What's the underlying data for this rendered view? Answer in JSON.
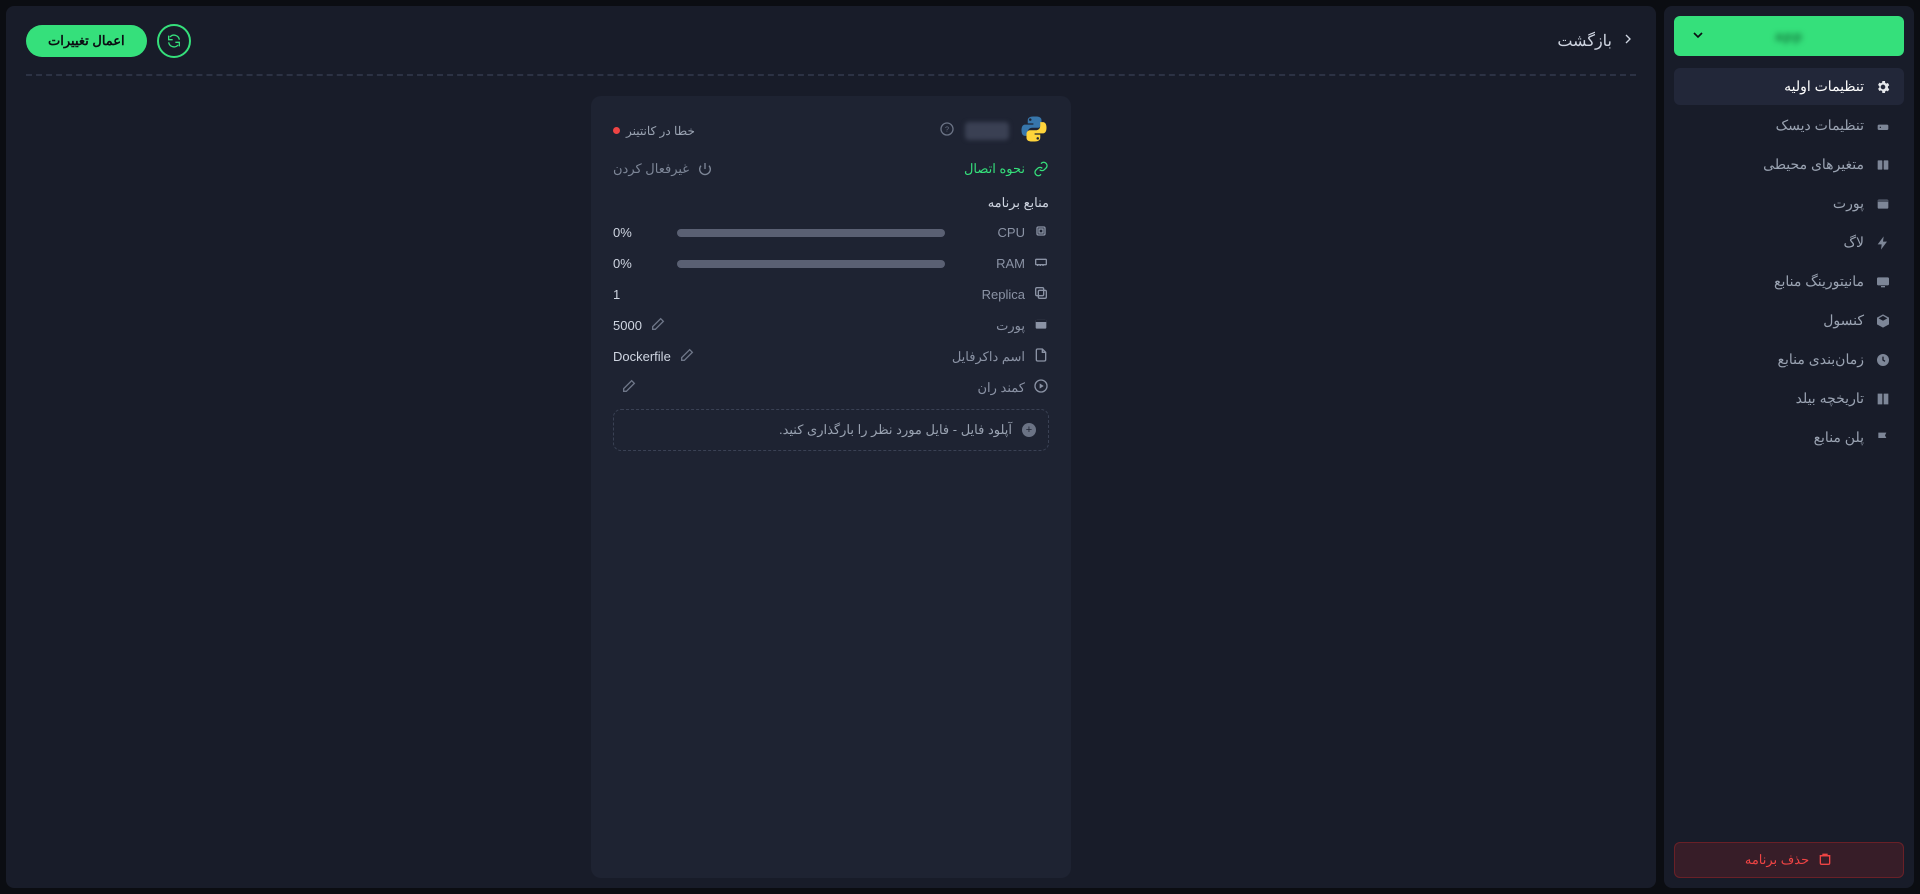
{
  "colors": {
    "accent": "#35e07b",
    "danger": "#ef4444",
    "bg": "#181c29",
    "card": "#1e2332"
  },
  "sidebar": {
    "project_label": "—",
    "items": [
      {
        "label": "تنظیمات اولیه",
        "active": true
      },
      {
        "label": "تنظیمات دیسک",
        "active": false
      },
      {
        "label": "متغیرهای محیطی",
        "active": false
      },
      {
        "label": "پورت",
        "active": false
      },
      {
        "label": "لاگ",
        "active": false
      },
      {
        "label": "مانیتورینگ منابع",
        "active": false
      },
      {
        "label": "کنسول",
        "active": false
      },
      {
        "label": "زمان‌بندی منابع",
        "active": false
      },
      {
        "label": "تاریخچه بیلد",
        "active": false
      },
      {
        "label": "پلن منابع",
        "active": false
      }
    ],
    "delete_label": "حذف برنامه"
  },
  "topbar": {
    "back_label": "بازگشت",
    "apply_label": "اعمال تغییرات"
  },
  "card": {
    "status_label": "خطا در کانتینر",
    "link_label": "نحوه اتصال",
    "disable_label": "غیرفعال کردن",
    "section_title": "منابع برنامه",
    "cpu": {
      "label": "CPU",
      "value": "0%",
      "percent": 0
    },
    "ram": {
      "label": "RAM",
      "value": "0%",
      "percent": 0
    },
    "replica": {
      "label": "Replica",
      "value": "1"
    },
    "port": {
      "label": "پورت",
      "value": "5000"
    },
    "dockerfile": {
      "label": "اسم داکرفایل",
      "value": "Dockerfile"
    },
    "command": {
      "label": "کمند ران",
      "value": ""
    },
    "upload": {
      "label": "آپلود فایل - فایل مورد نظر را بارگذاری کنید."
    }
  }
}
